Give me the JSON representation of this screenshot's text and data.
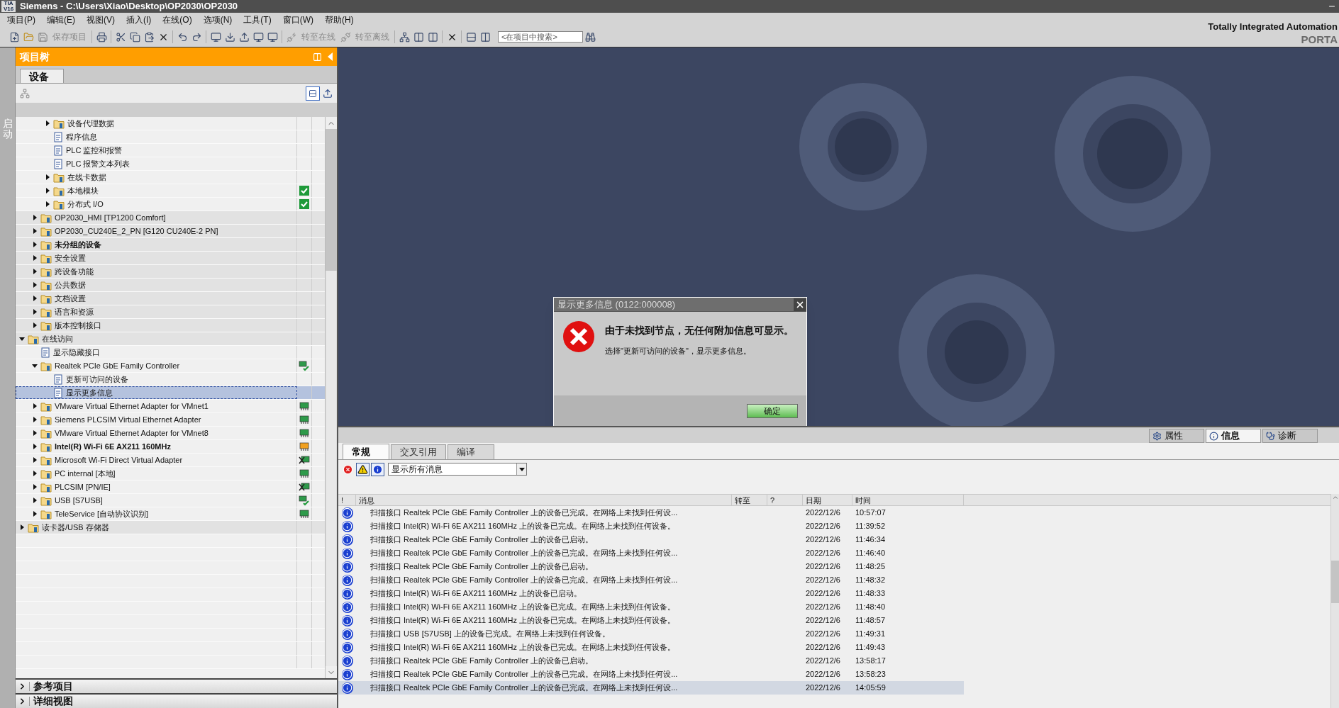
{
  "title_bar": {
    "logo": {
      "top": "TIA",
      "bottom": "V16"
    },
    "title": "Siemens  -  C:\\Users\\Xiao\\Desktop\\OP2030\\OP2030"
  },
  "menu": [
    "项目(P)",
    "编辑(E)",
    "视图(V)",
    "插入(I)",
    "在线(O)",
    "选项(N)",
    "工具(T)",
    "窗口(W)",
    "帮助(H)"
  ],
  "toolbar": {
    "buttons": [
      {
        "label": "保存项目",
        "disabled": true
      },
      {
        "label": "转至在线",
        "disabled": true
      },
      {
        "label": "转至离线",
        "disabled": true
      }
    ],
    "search": {
      "placeholder": "<在项目中搜索>"
    }
  },
  "branding": {
    "line1": "Totally Integrated Automation",
    "line2": "PORTA"
  },
  "side_strip": {
    "label": "启动"
  },
  "project_tree": {
    "title": "项目树",
    "tabs": [
      {
        "label": "设备",
        "selected": true
      }
    ],
    "items": [
      {
        "children": [
          {
            "children": [
              {
                "label": "设备代理数据",
                "expanded": false
              },
              {
                "label": "程序信息"
              },
              {
                "label": "PLC 监控和报警"
              },
              {
                "label": "PLC 报警文本列表"
              },
              {
                "label": "在线卡数据",
                "expanded": false
              },
              {
                "label": "本地模块",
                "expanded": false,
                "status": {
                  "kind": "check"
                }
              },
              {
                "label": "分布式 I/O",
                "expanded": false,
                "status": {
                  "kind": "check"
                }
              }
            ]
          },
          {
            "label": "OP2030_HMI [TP1200 Comfort]",
            "expanded": false
          },
          {
            "label": "OP2030_CU240E_2_PN [G120 CU240E-2 PN]",
            "expanded": false
          },
          {
            "label": "未分组的设备",
            "expanded": false,
            "bold": true
          },
          {
            "label": "安全设置",
            "expanded": false
          },
          {
            "label": "跨设备功能",
            "expanded": false
          },
          {
            "label": "公共数据",
            "expanded": false
          },
          {
            "label": "文档设置",
            "expanded": false
          },
          {
            "label": "语言和资源",
            "expanded": false
          },
          {
            "label": "版本控制接口",
            "expanded": false
          }
        ]
      },
      {
        "label": "在线访问",
        "expanded": true,
        "children": [
          {
            "label": "显示隐藏接口"
          },
          {
            "label": "Realtek PCIe GbE Family Controller",
            "expanded": true,
            "status": {
              "kind": "network-check"
            },
            "children": [
              {
                "label": "更新可访问的设备",
                "selected": false
              },
              {
                "label": "显示更多信息",
                "selected": true
              }
            ]
          },
          {
            "label": "VMware Virtual Ethernet Adapter for VMnet1",
            "expanded": false,
            "status": {
              "kind": "network"
            }
          },
          {
            "label": "Siemens PLCSIM Virtual Ethernet Adapter",
            "expanded": false,
            "status": {
              "kind": "network"
            }
          },
          {
            "label": "VMware Virtual Ethernet Adapter for VMnet8",
            "expanded": false,
            "status": {
              "kind": "network"
            }
          },
          {
            "label": "Intel(R) Wi-Fi 6E AX211 160MHz",
            "expanded": false,
            "bold": true,
            "status": {
              "kind": "network-warning"
            }
          },
          {
            "label": "Microsoft Wi-Fi Direct Virtual Adapter",
            "expanded": false,
            "status": {
              "kind": "network-off"
            }
          },
          {
            "label": "PC internal [本地]",
            "expanded": false,
            "status": {
              "kind": "network"
            }
          },
          {
            "label": "PLCSIM [PN/IE]",
            "expanded": false,
            "status": {
              "kind": "network-off"
            }
          },
          {
            "label": "USB [S7USB]",
            "expanded": false,
            "status": {
              "kind": "network-check"
            }
          },
          {
            "label": "TeleService [自动协议识别]",
            "expanded": false,
            "status": {
              "kind": "network"
            }
          }
        ]
      },
      {
        "label": "读卡器/USB 存储器",
        "expanded": false
      }
    ],
    "bottom_sections": [
      {
        "label": "参考项目",
        "expanded": false
      },
      {
        "label": "详细视图",
        "expanded": false
      }
    ]
  },
  "dialog": {
    "title": "显示更多信息 (0122:000008)",
    "message": "由于未找到节点，无任何附加信息可显示。",
    "detail": "选择\"更新可访问的设备\"，显示更多信息。",
    "button": "确定"
  },
  "inspector": {
    "tabs": [
      {
        "label": "属性",
        "selected": false
      },
      {
        "label": "信息",
        "selected": true
      },
      {
        "label": "诊断",
        "selected": false
      }
    ],
    "sub_tabs": [
      {
        "label": "常规",
        "selected": true
      },
      {
        "label": "交叉引用",
        "selected": false
      },
      {
        "label": "编译",
        "selected": false
      }
    ],
    "filters": [
      {
        "kind": "error",
        "on": false
      },
      {
        "kind": "warning",
        "on": true
      },
      {
        "kind": "info",
        "on": true
      }
    ],
    "filter_select": {
      "value": "显示所有消息"
    },
    "table": {
      "columns": [
        "!",
        "消息",
        "转至",
        "?",
        "日期",
        "时间"
      ],
      "rows": [
        {
          "kind": "info",
          "message": "扫描接口 Realtek PCIe GbE Family Controller 上的设备已完成。在网络上未找到任何设...",
          "date": "2022/12/6",
          "time": "10:57:07",
          "selected": false
        },
        {
          "kind": "info",
          "message": "扫描接口 Intel(R) Wi-Fi 6E AX211 160MHz 上的设备已完成。在网络上未找到任何设备。",
          "date": "2022/12/6",
          "time": "11:39:52",
          "selected": false
        },
        {
          "kind": "info",
          "message": "扫描接口 Realtek PCIe GbE Family Controller 上的设备已启动。",
          "date": "2022/12/6",
          "time": "11:46:34",
          "selected": false
        },
        {
          "kind": "info",
          "message": "扫描接口 Realtek PCIe GbE Family Controller 上的设备已完成。在网络上未找到任何设...",
          "date": "2022/12/6",
          "time": "11:46:40",
          "selected": false
        },
        {
          "kind": "info",
          "message": "扫描接口 Realtek PCIe GbE Family Controller 上的设备已启动。",
          "date": "2022/12/6",
          "time": "11:48:25",
          "selected": false
        },
        {
          "kind": "info",
          "message": "扫描接口 Realtek PCIe GbE Family Controller 上的设备已完成。在网络上未找到任何设...",
          "date": "2022/12/6",
          "time": "11:48:32",
          "selected": false
        },
        {
          "kind": "info",
          "message": "扫描接口 Intel(R) Wi-Fi 6E AX211 160MHz 上的设备已启动。",
          "date": "2022/12/6",
          "time": "11:48:33",
          "selected": false
        },
        {
          "kind": "info",
          "message": "扫描接口 Intel(R) Wi-Fi 6E AX211 160MHz 上的设备已完成。在网络上未找到任何设备。",
          "date": "2022/12/6",
          "time": "11:48:40",
          "selected": false
        },
        {
          "kind": "info",
          "message": "扫描接口 Intel(R) Wi-Fi 6E AX211 160MHz 上的设备已完成。在网络上未找到任何设备。",
          "date": "2022/12/6",
          "time": "11:48:57",
          "selected": false
        },
        {
          "kind": "info",
          "message": "扫描接口 USB [S7USB] 上的设备已完成。在网络上未找到任何设备。",
          "date": "2022/12/6",
          "time": "11:49:31",
          "selected": false
        },
        {
          "kind": "info",
          "message": "扫描接口 Intel(R) Wi-Fi 6E AX211 160MHz 上的设备已完成。在网络上未找到任何设备。",
          "date": "2022/12/6",
          "time": "11:49:43",
          "selected": false
        },
        {
          "kind": "info",
          "message": "扫描接口 Realtek PCIe GbE Family Controller 上的设备已启动。",
          "date": "2022/12/6",
          "time": "13:58:17",
          "selected": false
        },
        {
          "kind": "info",
          "message": "扫描接口 Realtek PCIe GbE Family Controller 上的设备已完成。在网络上未找到任何设...",
          "date": "2022/12/6",
          "time": "13:58:23",
          "selected": false
        },
        {
          "kind": "info",
          "message": "扫描接口 Realtek PCIe GbE Family Controller 上的设备已完成。在网络上未找到任何设...",
          "date": "2022/12/6",
          "time": "14:05:59",
          "selected": true
        }
      ]
    }
  }
}
